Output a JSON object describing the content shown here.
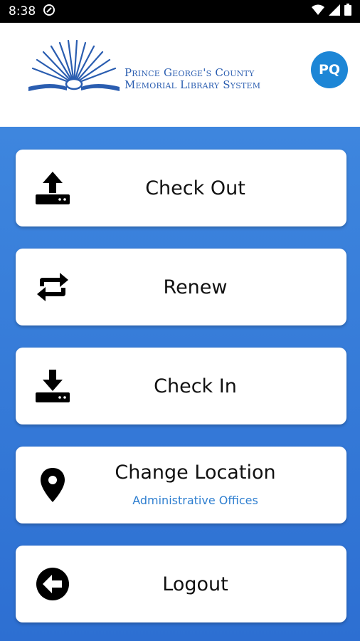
{
  "status_bar": {
    "time": "8:38",
    "icons": [
      "notification-icon",
      "wifi-icon",
      "cellular-icon",
      "battery-icon"
    ]
  },
  "header": {
    "logo_line1": "Prince George's County",
    "logo_line2": "Memorial Library System",
    "avatar_initials": "PQ"
  },
  "menu": [
    {
      "label": "Check Out",
      "icon": "upload-tray-icon"
    },
    {
      "label": "Renew",
      "icon": "repeat-arrows-icon"
    },
    {
      "label": "Check In",
      "icon": "download-tray-icon"
    },
    {
      "label": "Change Location",
      "sublabel": "Administrative Offices",
      "icon": "location-pin-icon"
    },
    {
      "label": "Logout",
      "icon": "back-arrow-circle-icon"
    }
  ],
  "colors": {
    "brand_blue": "#2a5db0",
    "avatar": "#1d86d6",
    "background_gradient_top": "#3e86de",
    "background_gradient_bottom": "#2d6fd2",
    "sublabel": "#2f7fd0"
  }
}
